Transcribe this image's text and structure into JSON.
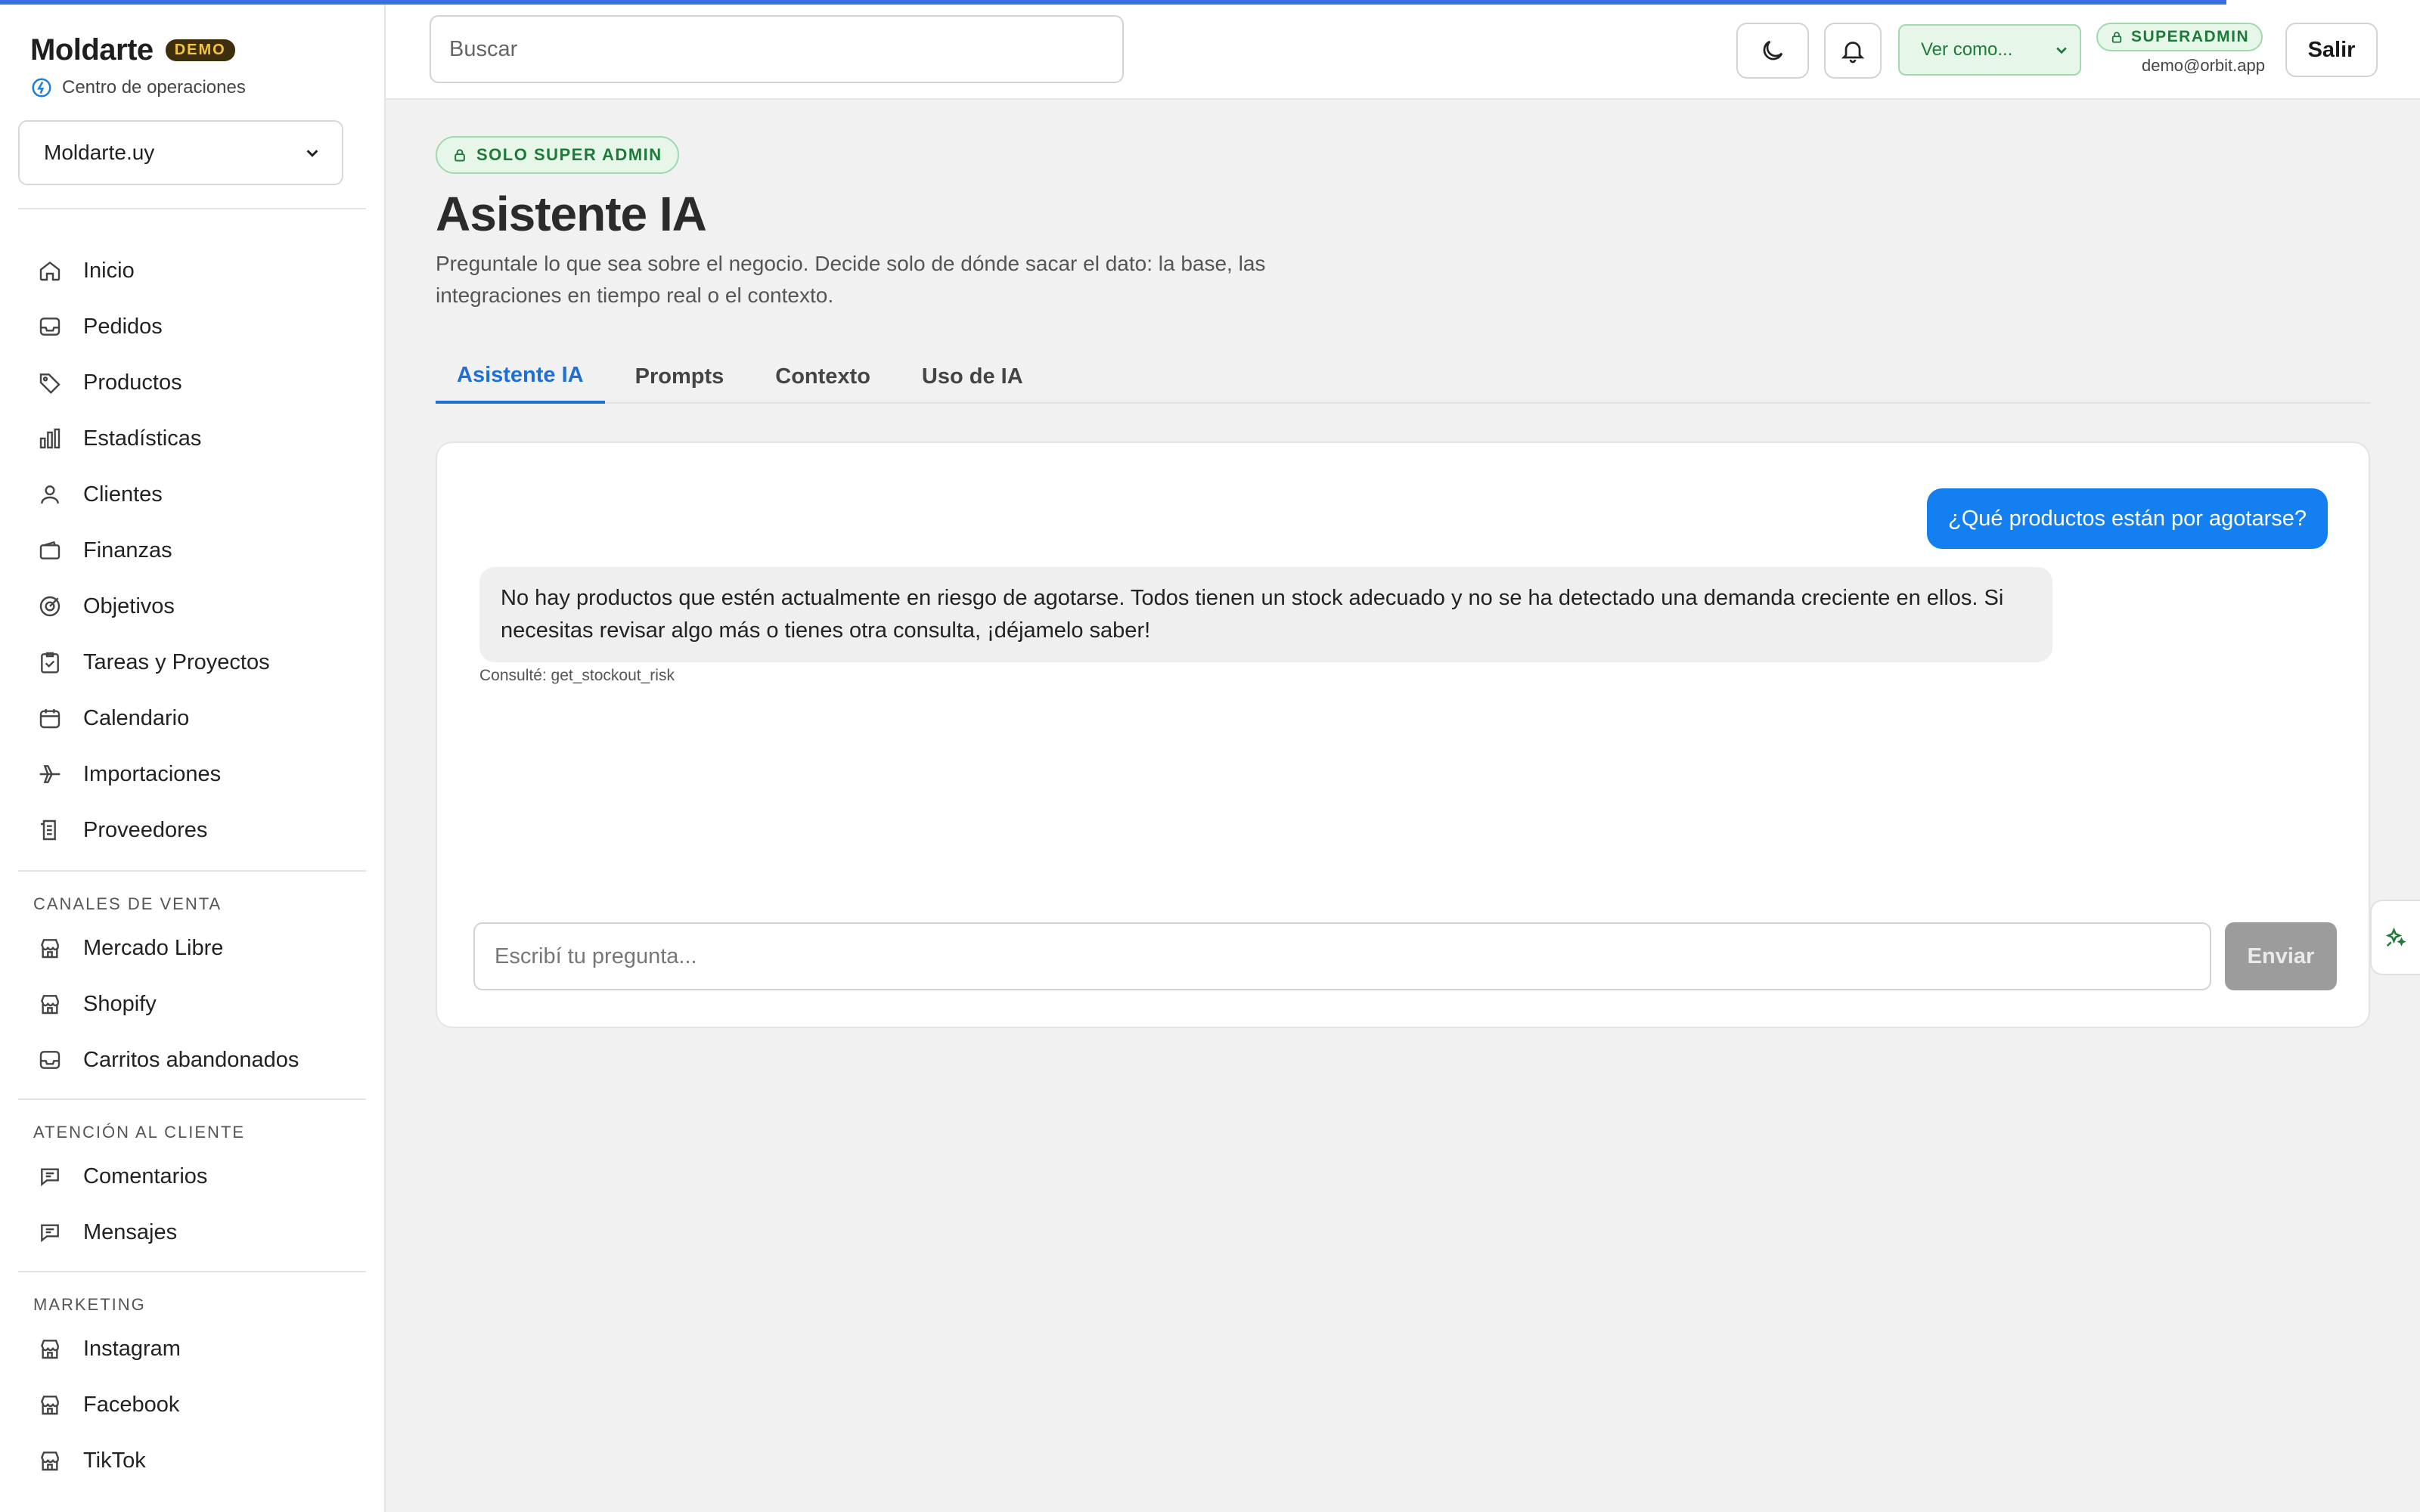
{
  "brand": {
    "name": "Moldarte",
    "badge": "DEMO",
    "subtitle": "Centro de operaciones",
    "store_selected": "Moldarte.uy"
  },
  "nav": {
    "main": [
      {
        "label": "Inicio",
        "icon": "home-icon"
      },
      {
        "label": "Pedidos",
        "icon": "inbox-icon"
      },
      {
        "label": "Productos",
        "icon": "tag-icon"
      },
      {
        "label": "Estadísticas",
        "icon": "bar-chart-icon"
      },
      {
        "label": "Clientes",
        "icon": "user-icon"
      },
      {
        "label": "Finanzas",
        "icon": "wallet-icon"
      },
      {
        "label": "Objetivos",
        "icon": "target-icon"
      },
      {
        "label": "Tareas y Proyectos",
        "icon": "clipboard-check-icon"
      },
      {
        "label": "Calendario",
        "icon": "calendar-icon"
      },
      {
        "label": "Importaciones",
        "icon": "plane-icon"
      },
      {
        "label": "Proveedores",
        "icon": "document-list-icon"
      }
    ],
    "sales_label": "CANALES DE VENTA",
    "sales": [
      {
        "label": "Mercado Libre",
        "icon": "store-icon"
      },
      {
        "label": "Shopify",
        "icon": "store-icon"
      },
      {
        "label": "Carritos abandonados",
        "icon": "inbox-icon"
      }
    ],
    "support_label": "ATENCIÓN AL CLIENTE",
    "support": [
      {
        "label": "Comentarios",
        "icon": "chat-icon"
      },
      {
        "label": "Mensajes",
        "icon": "chat-icon"
      }
    ],
    "marketing_label": "MARKETING",
    "marketing": [
      {
        "label": "Instagram",
        "icon": "store-icon"
      },
      {
        "label": "Facebook",
        "icon": "store-icon"
      },
      {
        "label": "TikTok",
        "icon": "store-icon"
      }
    ]
  },
  "topbar": {
    "search_placeholder": "Buscar",
    "view_as": "Ver como...",
    "role_badge": "SUPERADMIN",
    "user_email": "demo@orbit.app",
    "logout": "Salir"
  },
  "page": {
    "admin_badge": "SOLO SUPER ADMIN",
    "title": "Asistente IA",
    "description": "Preguntale lo que sea sobre el negocio. Decide solo de dónde sacar el dato: la base, las integraciones en tiempo real o el contexto.",
    "tabs": [
      "Asistente IA",
      "Prompts",
      "Contexto",
      "Uso de IA"
    ],
    "active_tab": "Asistente IA"
  },
  "chat": {
    "user_message": "¿Qué productos están por agotarse?",
    "assistant_message": "No hay productos que estén actualmente en riesgo de agotarse. Todos tienen un stock adecuado y no se ha detectado una demanda creciente en ellos. Si necesitas revisar algo más o tienes otra consulta, ¡déjamelo saber!",
    "tool_note": "Consulté: get_stockout_risk",
    "input_placeholder": "Escribí tu pregunta...",
    "send_label": "Enviar"
  },
  "colors": {
    "accent": "#1e6fd6",
    "user_bubble": "#147ff0",
    "success_bg": "#e6f7ea",
    "success_text": "#1e7a39",
    "progress": "#3b6fe0"
  }
}
